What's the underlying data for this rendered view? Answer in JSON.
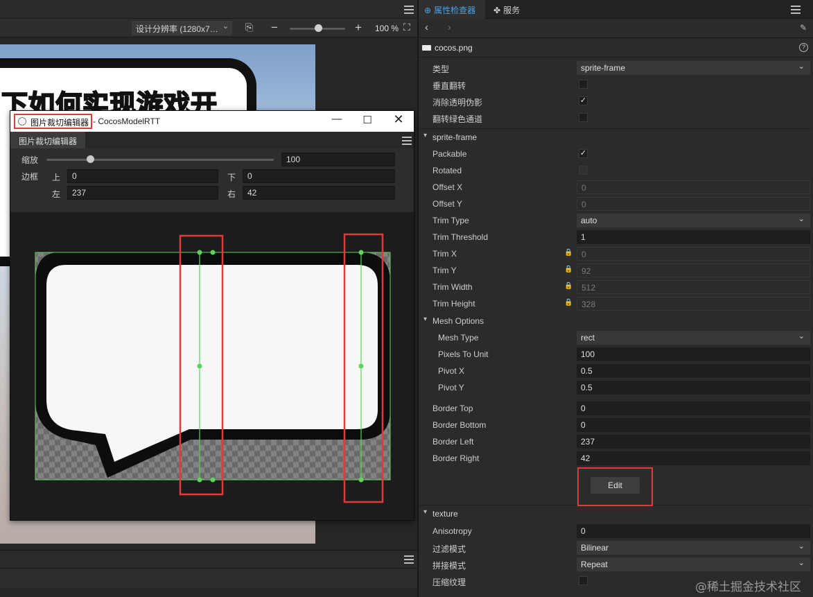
{
  "scene": {
    "resolution_label": "设计分辨率 (1280x7…",
    "zoom_label": "100 %",
    "banner_text": "下如何实现游戏开"
  },
  "sprite_editor": {
    "title_highlight": "图片裁切编辑器",
    "title_rest": "- CocosModelRTT",
    "tab_label": "图片裁切编辑器",
    "scale_label": "缩放",
    "scale_value": "100",
    "border_label": "边框",
    "top_label": "上",
    "top_value": "0",
    "bottom_label": "下",
    "bottom_value": "0",
    "left_label": "左",
    "left_value": "237",
    "right_label": "右",
    "right_value": "42"
  },
  "inspector": {
    "tab_inspector": "属性检查器",
    "tab_services": "服务",
    "asset_name": "cocos.png",
    "image_rows": [
      {
        "label": "类型",
        "kind": "select",
        "value": "sprite-frame"
      },
      {
        "label": "垂直翻转",
        "kind": "check",
        "checked": false
      },
      {
        "label": "消除透明伪影",
        "kind": "check",
        "checked": true
      },
      {
        "label": "翻转绿色通道",
        "kind": "check",
        "checked": false
      }
    ],
    "sprite_frame_section": "sprite-frame",
    "sprite_rows": [
      {
        "label": "Packable",
        "kind": "check",
        "checked": true
      },
      {
        "label": "Rotated",
        "kind": "check",
        "checked": false,
        "disabled": true
      },
      {
        "label": "Offset X",
        "kind": "text",
        "value": "0",
        "disabled": true
      },
      {
        "label": "Offset Y",
        "kind": "text",
        "value": "0",
        "disabled": true
      },
      {
        "label": "Trim Type",
        "kind": "select",
        "value": "auto"
      },
      {
        "label": "Trim Threshold",
        "kind": "text",
        "value": "1"
      },
      {
        "label": "Trim X",
        "kind": "text",
        "value": "0",
        "disabled": true,
        "locked": true
      },
      {
        "label": "Trim Y",
        "kind": "text",
        "value": "92",
        "disabled": true,
        "locked": true
      },
      {
        "label": "Trim Width",
        "kind": "text",
        "value": "512",
        "disabled": true,
        "locked": true
      },
      {
        "label": "Trim Height",
        "kind": "text",
        "value": "328",
        "disabled": true,
        "locked": true
      }
    ],
    "mesh_options_label": "Mesh Options",
    "mesh_rows": [
      {
        "label": "Mesh Type",
        "kind": "select",
        "value": "rect"
      },
      {
        "label": "Pixels To Unit",
        "kind": "text",
        "value": "100"
      },
      {
        "label": "Pivot X",
        "kind": "text",
        "value": "0.5"
      },
      {
        "label": "Pivot Y",
        "kind": "text",
        "value": "0.5"
      }
    ],
    "border_rows": [
      {
        "label": "Border Top",
        "kind": "text",
        "value": "0"
      },
      {
        "label": "Border Bottom",
        "kind": "text",
        "value": "0"
      },
      {
        "label": "Border Left",
        "kind": "text",
        "value": "237"
      },
      {
        "label": "Border Right",
        "kind": "text",
        "value": "42"
      }
    ],
    "edit_button": "Edit",
    "texture_section": "texture",
    "texture_rows": [
      {
        "label": "Anisotropy",
        "kind": "text",
        "value": "0"
      },
      {
        "label": "过滤模式",
        "kind": "select",
        "value": "Bilinear"
      },
      {
        "label": "拼接模式",
        "kind": "select",
        "value": "Repeat"
      },
      {
        "label": "压缩纹理",
        "kind": "check",
        "checked": false
      }
    ]
  },
  "watermark": "@稀土掘金技术社区",
  "colors": {
    "accent_blue": "#4aa3e8",
    "highlight_red": "#e03a3a",
    "guide_green": "#5fd35f"
  }
}
